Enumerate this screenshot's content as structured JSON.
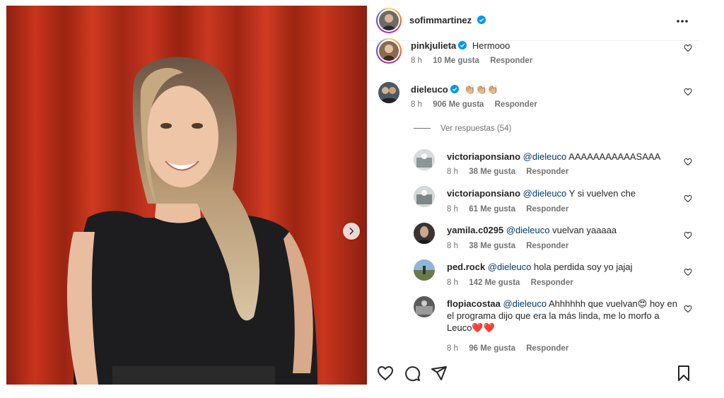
{
  "post": {
    "author": "sofimmartinez",
    "more_icon": "more-horizontal-icon"
  },
  "comments": [
    {
      "username": "pinkjulieta",
      "verified": true,
      "text": "Hermooo",
      "time": "8 h",
      "likes": "10 Me gusta",
      "reply": "Responder"
    },
    {
      "username": "dieleuco",
      "verified": true,
      "text": "👏🏼👏🏼👏🏼",
      "time": "8 h",
      "likes": "906 Me gusta",
      "reply": "Responder"
    }
  ],
  "view_replies": "Ver respuestas (54)",
  "replies": [
    {
      "username": "victoriaponsiano",
      "mention": "@dieleuco",
      "text": " AAAAAAAAAAASAAA",
      "time": "8 h",
      "likes": "38 Me gusta",
      "reply": "Responder"
    },
    {
      "username": "victoriaponsiano",
      "mention": "@dieleuco",
      "text": " Y si vuelven che",
      "time": "8 h",
      "likes": "61 Me gusta",
      "reply": "Responder"
    },
    {
      "username": "yamila.c0295",
      "mention": "@dieleuco",
      "text": " vuelvan yaaaaa",
      "time": "8 h",
      "likes": "38 Me gusta",
      "reply": "Responder"
    },
    {
      "username": "ped.rock",
      "mention": "@dieleuco",
      "text": " hola perdida soy yo jajaj",
      "time": "8 h",
      "likes": "142 Me gusta",
      "reply": "Responder"
    },
    {
      "username": "flopiacostaa",
      "mention": "@dieleuco",
      "text": " Ahhhhhh que vuelvan😍 hoy en el programa dijo que era la más linda, me lo morfo a Leuco❤️❤️",
      "time": "8 h",
      "likes": "96 Me gusta",
      "reply": "Responder"
    }
  ],
  "actions": [
    "heart-icon",
    "comment-icon",
    "share-icon",
    "save-icon"
  ],
  "colors": {
    "accent_verified": "#0095f6",
    "mention": "#00376b",
    "meta": "#737373",
    "curtain": "#b02a16"
  }
}
